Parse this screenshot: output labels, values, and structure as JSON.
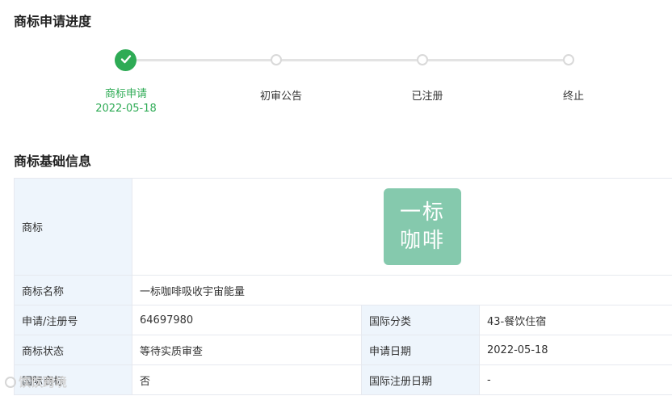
{
  "progress": {
    "title": "商标申请进度",
    "steps": [
      {
        "label": "商标申请",
        "date": "2022-05-18",
        "status": "done"
      },
      {
        "label": "初审公告",
        "date": "",
        "status": "pending"
      },
      {
        "label": "已注册",
        "date": "",
        "status": "pending"
      },
      {
        "label": "终止",
        "date": "",
        "status": "pending"
      }
    ],
    "colors": {
      "done": "#2eab55",
      "pending": "#d9d9d9"
    },
    "done_icon": "check-icon"
  },
  "info": {
    "title": "商标基础信息",
    "trademark_label": "商标",
    "trademark_image_text": [
      "一标",
      "咖啡"
    ],
    "trademark_image_color": "#85c9ad",
    "name_label": "商标名称",
    "name_value": "一标咖啡吸收宇宙能量",
    "reg_no_label": "申请/注册号",
    "reg_no_value": "64697980",
    "intl_class_label": "国际分类",
    "intl_class_value": "43-餐饮住宿",
    "status_label": "商标状态",
    "status_value": "等待实质审查",
    "apply_date_label": "申请日期",
    "apply_date_value": "2022-05-18",
    "intl_tm_label": "国际商标",
    "intl_tm_value": "否",
    "intl_reg_date_label": "国际注册日期",
    "intl_reg_date_value": "-"
  },
  "watermark": {
    "text": "饮饮跨境"
  }
}
